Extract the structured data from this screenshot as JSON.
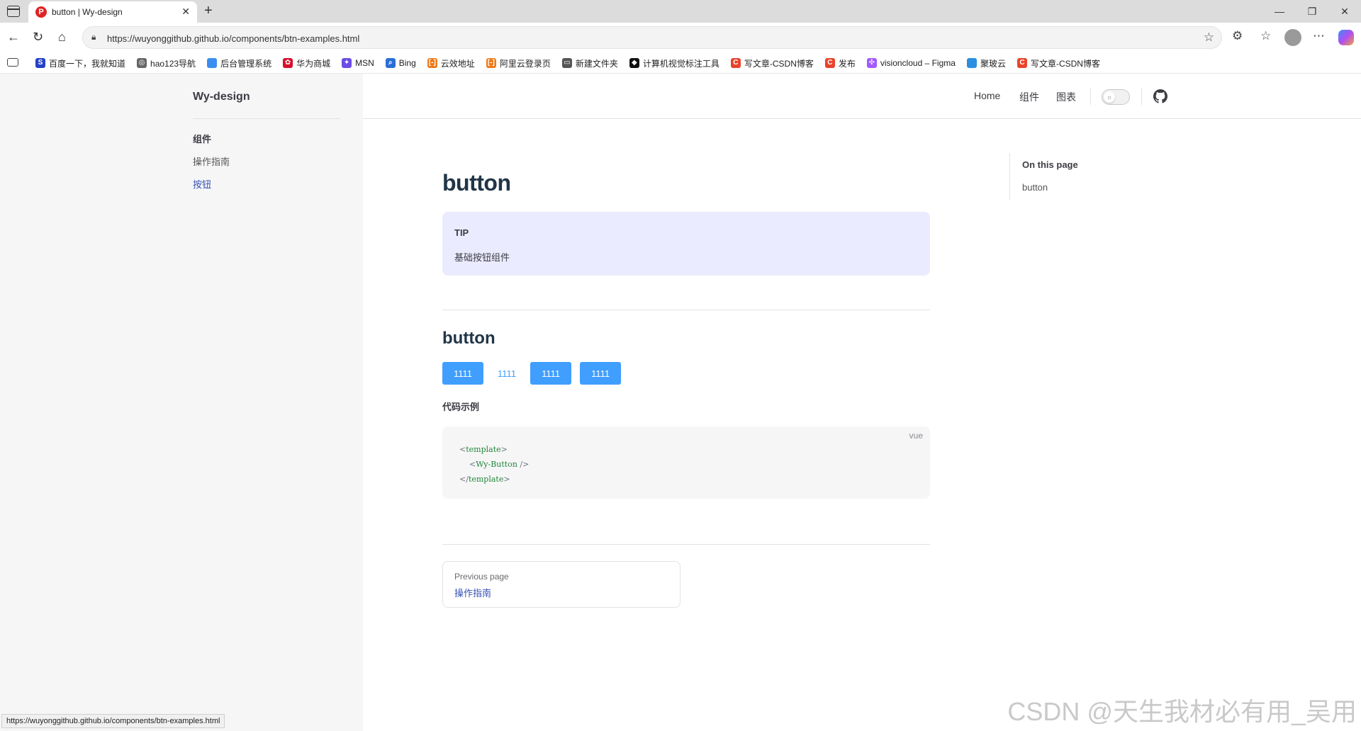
{
  "browser": {
    "tab_title": "button | Wy-design",
    "url": "https://wuyonggithub.github.io/components/btn-examples.html",
    "bookmarks": [
      {
        "label": "百度一下，我就知道",
        "color": "#2441c8",
        "glyph": "S"
      },
      {
        "label": "hao123导航",
        "color": "#666666",
        "glyph": "◎"
      },
      {
        "label": "后台管理系统",
        "color": "#3b8ef0",
        "glyph": ""
      },
      {
        "label": "华为商城",
        "color": "#d6102b",
        "glyph": "✿"
      },
      {
        "label": "MSN",
        "color": "#6b4de6",
        "glyph": "✦"
      },
      {
        "label": "Bing",
        "color": "#2b6fd6",
        "glyph": "⌕"
      },
      {
        "label": "云效地址",
        "color": "#f07a1a",
        "glyph": "[-]"
      },
      {
        "label": "阿里云登录页",
        "color": "#f07a1a",
        "glyph": "[-]"
      },
      {
        "label": "新建文件夹",
        "color": "#555555",
        "glyph": "▭"
      },
      {
        "label": "计算机视觉标注工具",
        "color": "#111111",
        "glyph": "◆"
      },
      {
        "label": "写文章-CSDN博客",
        "color": "#e8442b",
        "glyph": "C"
      },
      {
        "label": "发布",
        "color": "#e8442b",
        "glyph": "C"
      },
      {
        "label": "visioncloud – Figma",
        "color": "#a259ff",
        "glyph": "✣"
      },
      {
        "label": "聚玻云",
        "color": "#2b8fe0",
        "glyph": ""
      },
      {
        "label": "写文章-CSDN博客",
        "color": "#e8442b",
        "glyph": "C"
      }
    ],
    "status_url": "https://wuyonggithub.github.io/components/btn-examples.html"
  },
  "sidebar": {
    "site_title": "Wy-design",
    "group_label": "组件",
    "items": [
      {
        "label": "操作指南",
        "active": false
      },
      {
        "label": "按钮",
        "active": true
      }
    ]
  },
  "topnav": {
    "links": [
      "Home",
      "组件",
      "图表"
    ]
  },
  "main": {
    "title": "button",
    "tip_title": "TIP",
    "tip_text": "基础按钮组件",
    "section_title": "button",
    "buttons": [
      {
        "label": "1111",
        "variant": "primary"
      },
      {
        "label": "1111",
        "variant": "text"
      },
      {
        "label": "1111",
        "variant": "primary"
      },
      {
        "label": "1111",
        "variant": "primary"
      }
    ],
    "code_heading": "代码示例",
    "code_lang": "vue",
    "code_lines": [
      {
        "open": "<",
        "tag": "template",
        "close": ">",
        "indent": ""
      },
      {
        "open": "<",
        "tag": "Wy-Button",
        "close": " />",
        "indent": "    "
      },
      {
        "open": "</",
        "tag": "template",
        "close": ">",
        "indent": ""
      }
    ],
    "prev_label": "Previous page",
    "prev_link": "操作指南"
  },
  "aside": {
    "title": "On this page",
    "link": "button"
  },
  "watermark": "CSDN @天生我材必有用_吴用",
  "colors": {
    "primary_button": "#409eff",
    "link": "#3451b2",
    "tip_bg": "#ebebff"
  }
}
